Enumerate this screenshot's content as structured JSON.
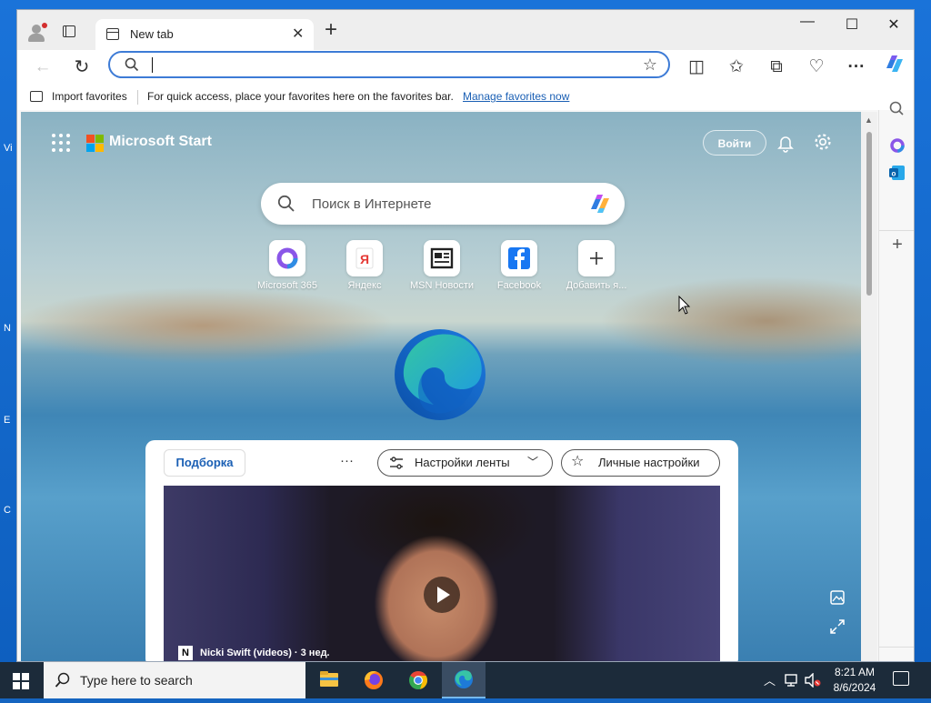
{
  "desktop": {
    "edge_labels": [
      "Vi",
      "N",
      "E",
      "C"
    ]
  },
  "browser": {
    "tab_title": "New tab",
    "omnibox_value": "",
    "favorites_bar": {
      "import_label": "Import favorites",
      "hint": "For quick access, place your favorites here on the favorites bar.",
      "manage_link": "Manage favorites now"
    }
  },
  "start_page": {
    "brand": "Microsoft Start",
    "signin_label": "Войти",
    "search_placeholder": "Поиск в Интернете",
    "quick_links": [
      {
        "label": "Microsoft 365",
        "icon": "m365-icon"
      },
      {
        "label": "Яндекс",
        "icon": "yandex-icon"
      },
      {
        "label": "MSN Новости",
        "icon": "msn-news-icon"
      },
      {
        "label": "Facebook",
        "icon": "facebook-icon"
      },
      {
        "label": "Добавить я...",
        "icon": "plus-icon"
      }
    ],
    "feed": {
      "tab_label": "Подборка",
      "more_label": "···",
      "feed_settings_label": "Настройки ленты",
      "personal_settings_label": "Личные настройки",
      "hero_source_badge": "N",
      "hero_source": "Nicki Swift (videos) · 3 нед."
    }
  },
  "taskbar": {
    "search_placeholder": "Type here to search",
    "time": "8:21 AM",
    "date": "8/6/2024"
  },
  "colors": {
    "accent": "#3d7bd6",
    "link": "#1a5fb4",
    "taskbar": "#1c2b3a",
    "desktop": "#1565c0"
  }
}
